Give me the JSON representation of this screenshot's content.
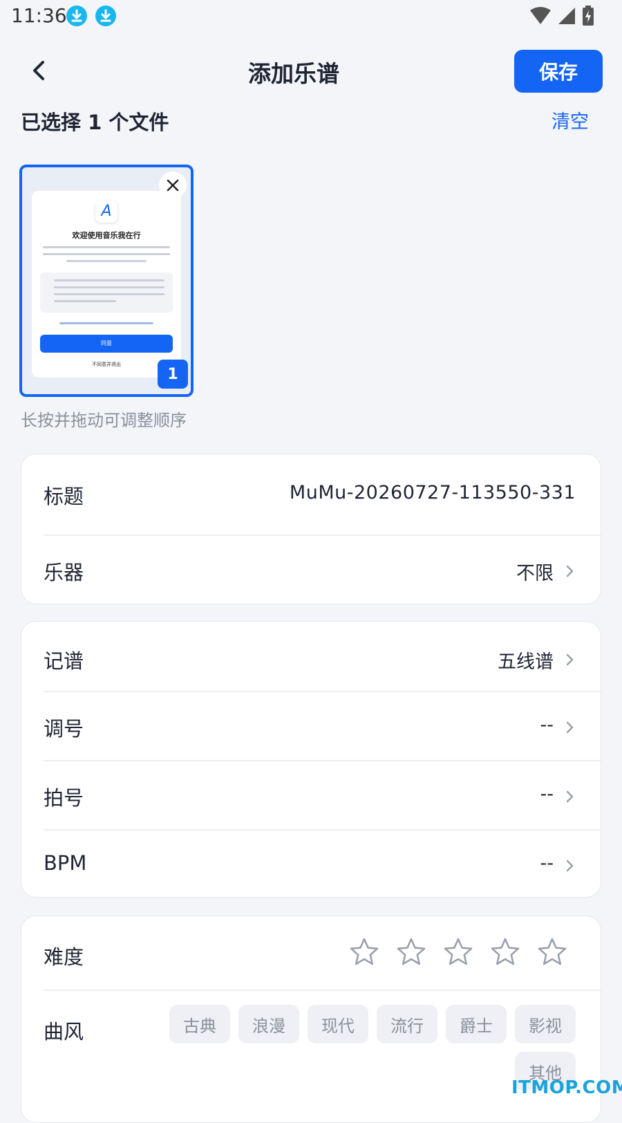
{
  "status_bar": {
    "time": "11:36"
  },
  "header": {
    "title": "添加乐谱",
    "save_label": "保存"
  },
  "selection": {
    "count_text": "已选择 1 个文件",
    "clear_label": "清空"
  },
  "thumbnail": {
    "heading": "欢迎使用音乐我在行",
    "agree_label": "同意",
    "exit_label": "不同意并退出",
    "index": "1"
  },
  "drag_hint": "长按并拖动可调整顺序",
  "basic_info": {
    "title_label": "标题",
    "title_value": "MuMu-20260727-113550-331",
    "instrument_label": "乐器",
    "instrument_value": "不限"
  },
  "notation_info": {
    "notation_label": "记谱",
    "notation_value": "五线谱",
    "key_label": "调号",
    "key_value": "--",
    "time_sig_label": "拍号",
    "time_sig_value": "--",
    "bpm_label": "BPM",
    "bpm_value": "--"
  },
  "style_info": {
    "difficulty_label": "难度",
    "difficulty_stars": 0,
    "difficulty_max": 5,
    "genre_label": "曲风",
    "genres": [
      "古典",
      "浪漫",
      "现代",
      "流行",
      "爵士",
      "影视",
      "其他"
    ]
  },
  "watermark": "ITMOP.COM",
  "colors": {
    "accent": "#1565f5",
    "background": "#f3f5f9",
    "chip_bg": "#eef0f5"
  }
}
